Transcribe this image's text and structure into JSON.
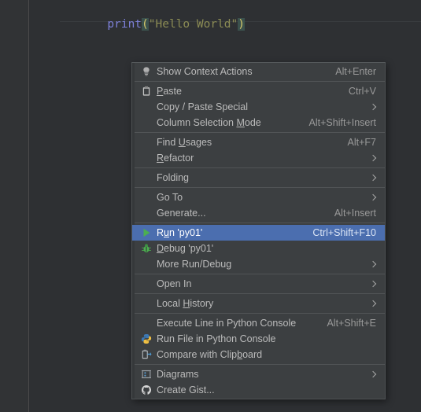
{
  "editor": {
    "code_tokens": [
      {
        "text": "print",
        "type": "function"
      },
      {
        "text": "(",
        "type": "paren"
      },
      {
        "text": "\"Hello World\"",
        "type": "string"
      },
      {
        "text": ")",
        "type": "paren"
      }
    ],
    "code_plain": "print(\"Hello World\")",
    "background": "#2e3033",
    "gutter_background": "#313335"
  },
  "context_menu": {
    "background": "#3c3f41",
    "selection_color": "#4b6eaf",
    "text_color": "#bbbbbb",
    "shortcut_color": "#999999",
    "groups": [
      {
        "items": [
          {
            "icon": "lightbulb-icon",
            "label_pre": "Show Context Actions",
            "mnemonic": "",
            "label_post": "",
            "shortcut": "Alt+Enter",
            "submenu": false,
            "selected": false
          }
        ]
      },
      {
        "items": [
          {
            "icon": "clipboard-paste-icon",
            "label_pre": "",
            "mnemonic": "P",
            "label_post": "aste",
            "shortcut": "Ctrl+V",
            "submenu": false,
            "selected": false
          },
          {
            "icon": "",
            "label_pre": "Copy / Paste Special",
            "mnemonic": "",
            "label_post": "",
            "shortcut": "",
            "submenu": true,
            "selected": false
          },
          {
            "icon": "",
            "label_pre": "Column Selection ",
            "mnemonic": "M",
            "label_post": "ode",
            "shortcut": "Alt+Shift+Insert",
            "submenu": false,
            "selected": false
          }
        ]
      },
      {
        "items": [
          {
            "icon": "",
            "label_pre": "Find ",
            "mnemonic": "U",
            "label_post": "sages",
            "shortcut": "Alt+F7",
            "submenu": false,
            "selected": false
          },
          {
            "icon": "",
            "label_pre": "",
            "mnemonic": "R",
            "label_post": "efactor",
            "shortcut": "",
            "submenu": true,
            "selected": false
          }
        ]
      },
      {
        "items": [
          {
            "icon": "",
            "label_pre": "Folding",
            "mnemonic": "",
            "label_post": "",
            "shortcut": "",
            "submenu": true,
            "selected": false
          }
        ]
      },
      {
        "items": [
          {
            "icon": "",
            "label_pre": "Go To",
            "mnemonic": "",
            "label_post": "",
            "shortcut": "",
            "submenu": true,
            "selected": false
          },
          {
            "icon": "",
            "label_pre": "Generate...",
            "mnemonic": "",
            "label_post": "",
            "shortcut": "Alt+Insert",
            "submenu": false,
            "selected": false
          }
        ]
      },
      {
        "items": [
          {
            "icon": "run-play-icon",
            "label_pre": "R",
            "mnemonic": "u",
            "label_post": "n 'py01'",
            "shortcut": "Ctrl+Shift+F10",
            "submenu": false,
            "selected": true
          },
          {
            "icon": "debug-bug-icon",
            "label_pre": "",
            "mnemonic": "D",
            "label_post": "ebug 'py01'",
            "shortcut": "",
            "submenu": false,
            "selected": false
          },
          {
            "icon": "",
            "label_pre": "More Run/Debug",
            "mnemonic": "",
            "label_post": "",
            "shortcut": "",
            "submenu": true,
            "selected": false
          }
        ]
      },
      {
        "items": [
          {
            "icon": "",
            "label_pre": "Open In",
            "mnemonic": "",
            "label_post": "",
            "shortcut": "",
            "submenu": true,
            "selected": false
          }
        ]
      },
      {
        "items": [
          {
            "icon": "",
            "label_pre": "Local ",
            "mnemonic": "H",
            "label_post": "istory",
            "shortcut": "",
            "submenu": true,
            "selected": false
          }
        ]
      },
      {
        "items": [
          {
            "icon": "",
            "label_pre": "Execute Line in Python Console",
            "mnemonic": "",
            "label_post": "",
            "shortcut": "Alt+Shift+E",
            "submenu": false,
            "selected": false
          },
          {
            "icon": "python-icon",
            "label_pre": "Run File in Python Console",
            "mnemonic": "",
            "label_post": "",
            "shortcut": "",
            "submenu": false,
            "selected": false
          },
          {
            "icon": "compare-clipboard-icon",
            "label_pre": "Compare with Clip",
            "mnemonic": "b",
            "label_post": "oard",
            "shortcut": "",
            "submenu": false,
            "selected": false
          }
        ]
      },
      {
        "items": [
          {
            "icon": "diagrams-icon",
            "label_pre": "Diagrams",
            "mnemonic": "",
            "label_post": "",
            "shortcut": "",
            "submenu": true,
            "selected": false
          },
          {
            "icon": "github-icon",
            "label_pre": "Create Gist...",
            "mnemonic": "",
            "label_post": "",
            "shortcut": "",
            "submenu": false,
            "selected": false
          }
        ]
      }
    ]
  }
}
